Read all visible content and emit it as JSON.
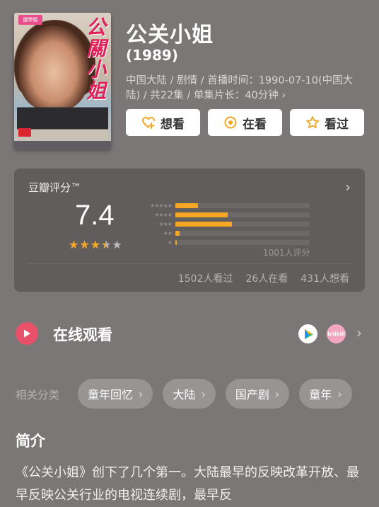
{
  "movie": {
    "title": "公关小姐",
    "year": "(1989)",
    "meta": "中国大陆 / 剧情 / 首播时间：1990-07-10(中国大陆) / 共22集 / 单集片长：40分钟 ›",
    "poster_title": "公關小姐",
    "poster_badge": "國學版",
    "poster_label": "",
    "poster_strip": ""
  },
  "actions": [
    {
      "label": "想看",
      "icon": "heart-plus-icon"
    },
    {
      "label": "在看",
      "icon": "target-icon"
    },
    {
      "label": "看过",
      "icon": "star-outline-icon"
    }
  ],
  "rating": {
    "label": "豆瓣评分™",
    "score": "7.4",
    "stars_value": 3.5,
    "stars_max": 5,
    "distribution": [
      {
        "stars": "★★★★★",
        "fraction": 0.17
      },
      {
        "stars": "★★★★",
        "fraction": 0.39
      },
      {
        "stars": "★★★",
        "fraction": 0.42
      },
      {
        "stars": "★★",
        "fraction": 0.03
      },
      {
        "stars": "★",
        "fraction": 0.005
      }
    ],
    "count": "1001人评分",
    "watched": "1502人看过",
    "watching": "26人在看",
    "want": "431人想看"
  },
  "online": {
    "label": "在线观看",
    "platform_1": "play-triangle-icon",
    "platform_2": "bilibili",
    "chevron": "›"
  },
  "related": {
    "label": "相关分类",
    "tags": [
      "童年回忆",
      "大陆",
      "国产剧",
      "童年"
    ]
  },
  "intro": {
    "title": "简介",
    "text": "《公关小姐》创下了几个第一。大陆最早的反映改革开放、最早反映公关行业的电视连续剧，最早反"
  },
  "colors": {
    "background": "#7a7776",
    "accent_star": "#f5a623",
    "play_red": "#e9516a"
  }
}
